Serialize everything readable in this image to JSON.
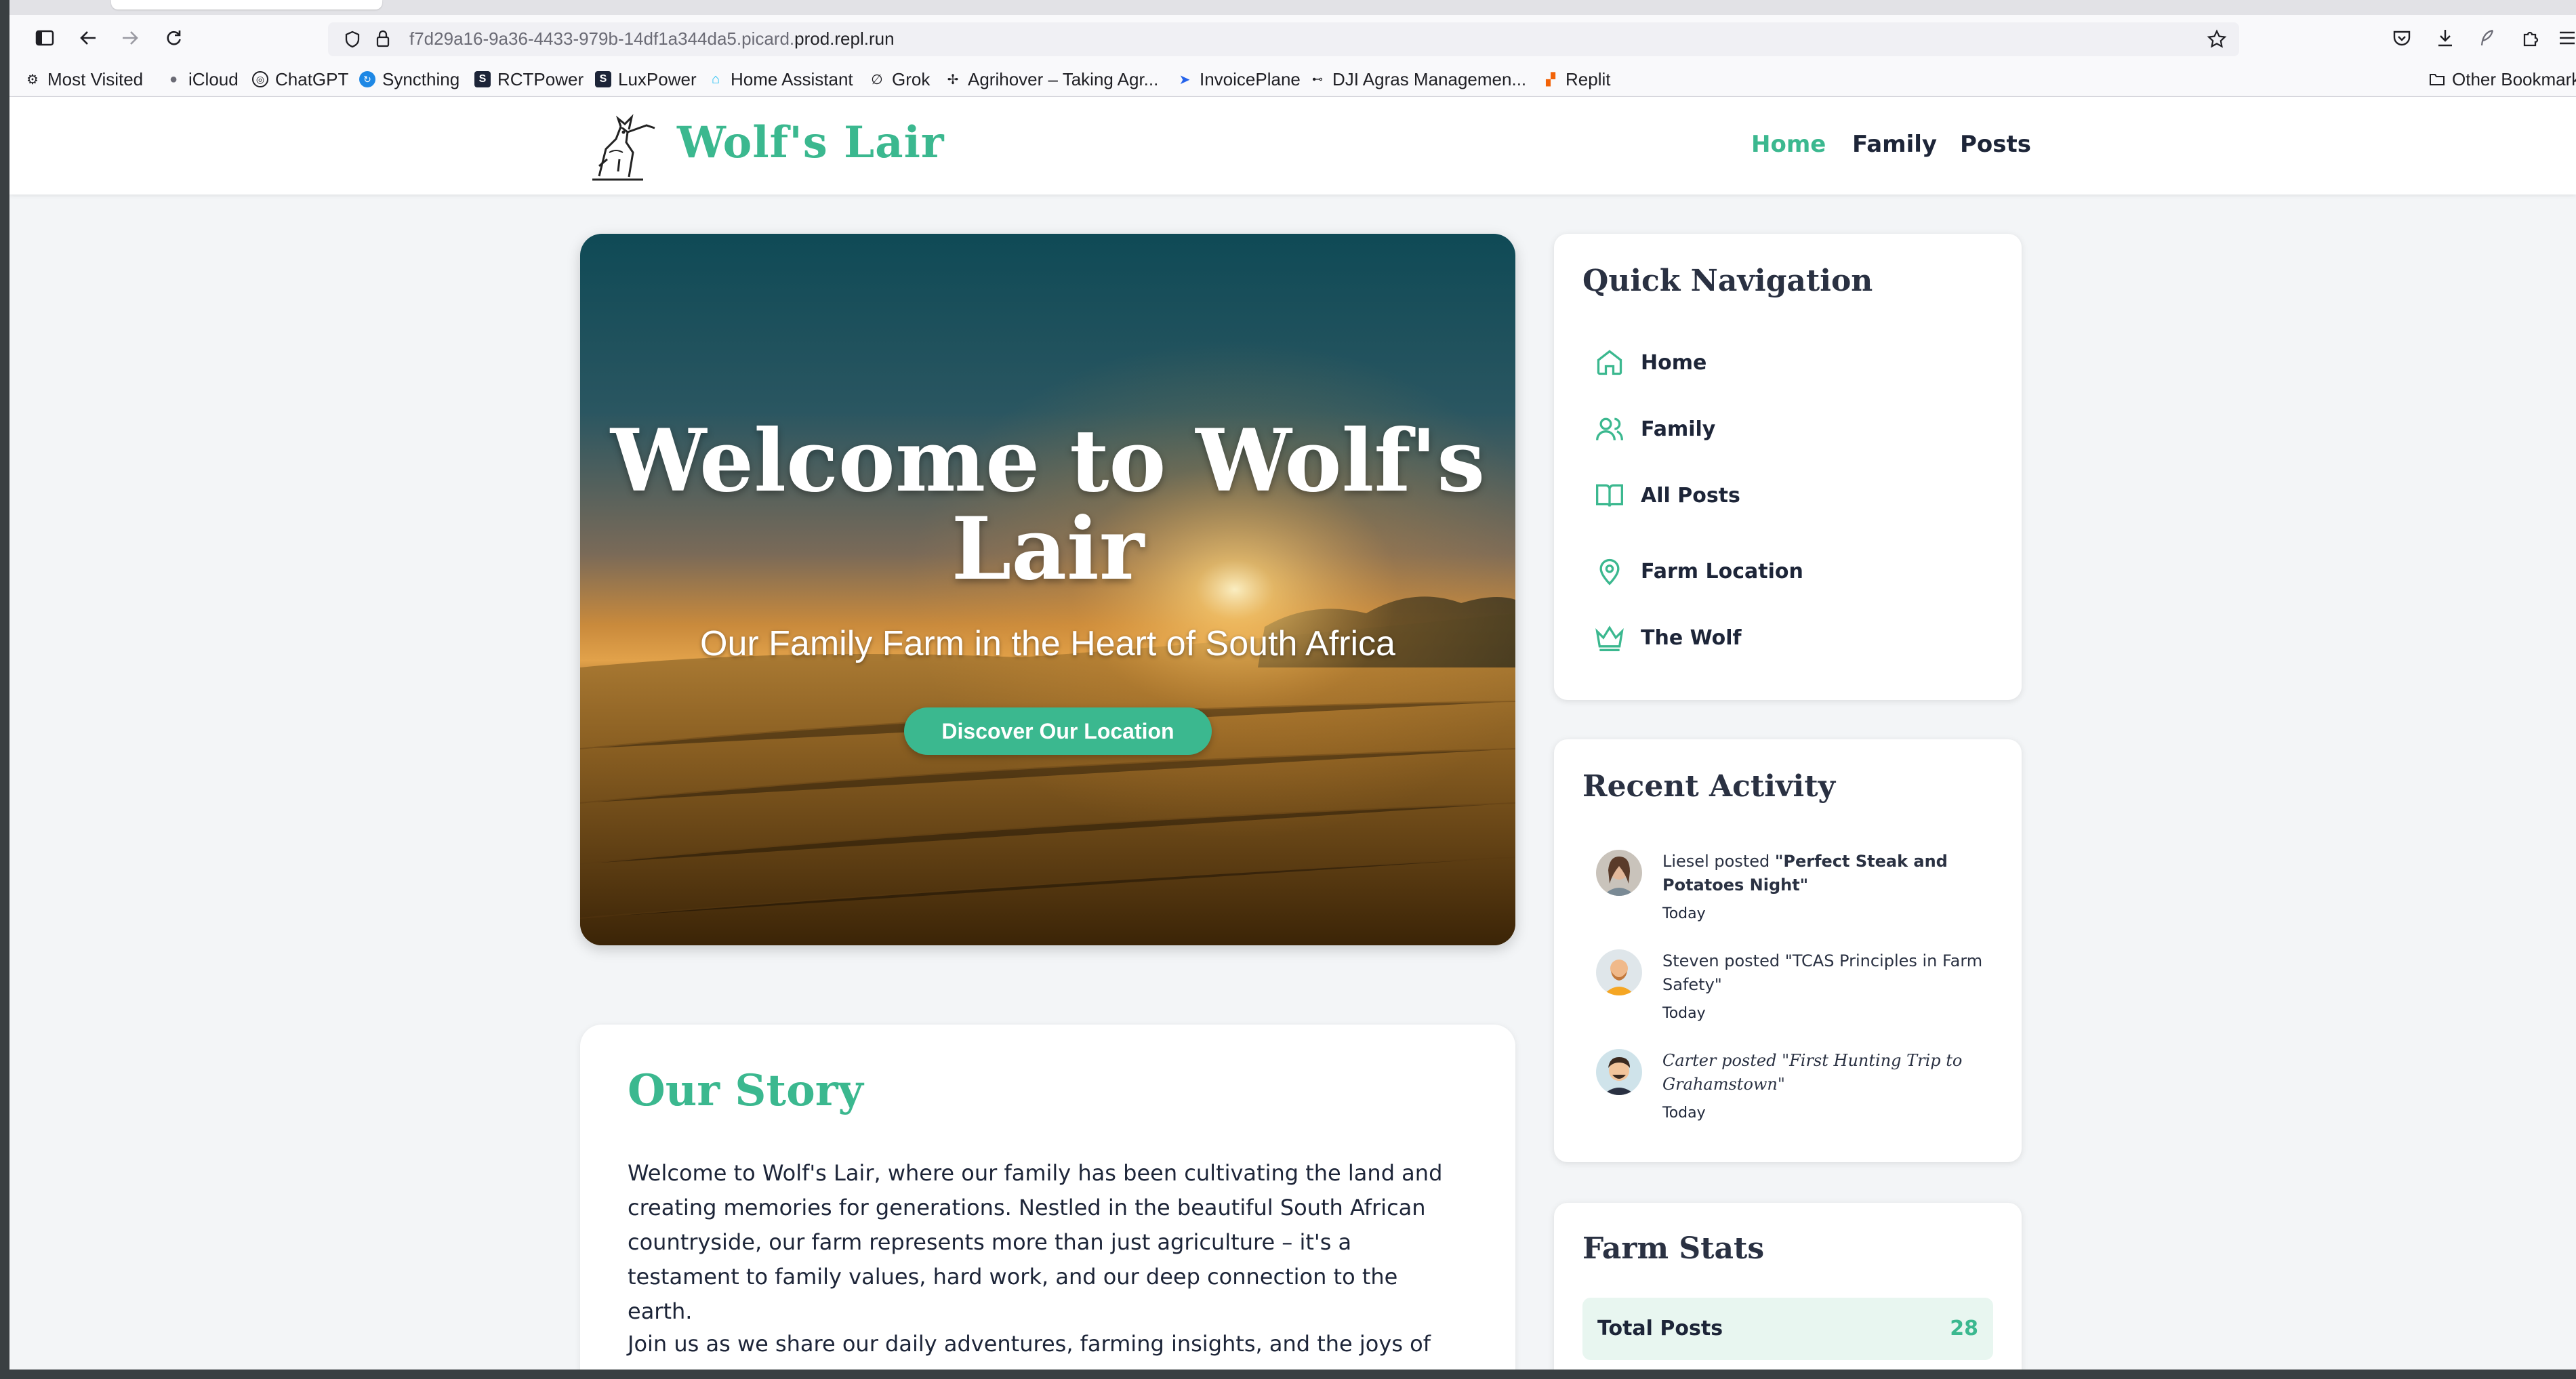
{
  "browser": {
    "url_path": "f7d29a16-9a36-4433-979b-14df1a344da5.picard.",
    "url_host": "prod.repl.run",
    "bookmarks": [
      {
        "label": "Most Visited",
        "icon": "gear-icon"
      },
      {
        "label": "iCloud",
        "icon": "apple-icon"
      },
      {
        "label": "ChatGPT",
        "icon": "chatgpt-icon"
      },
      {
        "label": "Syncthing",
        "icon": "syncthing-icon"
      },
      {
        "label": "RCTPower",
        "icon": "s-icon"
      },
      {
        "label": "LuxPower",
        "icon": "s-icon"
      },
      {
        "label": "Home Assistant",
        "icon": "home-assistant-icon"
      },
      {
        "label": "Grok",
        "icon": "grok-icon"
      },
      {
        "label": "Agrihover – Taking Agr...",
        "icon": "drone-icon"
      },
      {
        "label": "InvoicePlane",
        "icon": "plane-icon"
      },
      {
        "label": "DJI Agras Managemen...",
        "icon": "dji-icon"
      },
      {
        "label": "Replit",
        "icon": "replit-icon"
      }
    ],
    "other_bookmarks": "Other Bookmarks"
  },
  "site": {
    "title": "Wolf's Lair",
    "nav": [
      "Home",
      "Family",
      "Posts"
    ],
    "active_nav": "Home"
  },
  "hero": {
    "title": "Welcome to Wolf's Lair",
    "subtitle": "Our Family Farm in the Heart of South Africa",
    "cta": "Discover Our Location"
  },
  "story": {
    "heading": "Our Story",
    "p1": "Welcome to Wolf's Lair, where our family has been cultivating the land and creating memories for generations. Nestled in the beautiful South African countryside, our farm represents more than just agriculture – it's a testament to family values, hard work, and our deep connection to the earth.",
    "p2": "Join us as we share our daily adventures, farming insights, and the joys of"
  },
  "quick_nav": {
    "heading": "Quick Navigation",
    "items": [
      {
        "label": "Home",
        "icon": "home-icon"
      },
      {
        "label": "Family",
        "icon": "users-icon"
      },
      {
        "label": "All Posts",
        "icon": "book-icon"
      },
      {
        "label": "Farm Location",
        "icon": "map-pin-icon"
      },
      {
        "label": "The Wolf",
        "icon": "crown-icon"
      }
    ]
  },
  "recent_activity": {
    "heading": "Recent Activity",
    "items": [
      {
        "author": "Liesel",
        "verb": "posted",
        "title": "\"Perfect Steak and Potatoes Night\"",
        "when": "Today"
      },
      {
        "author": "Steven",
        "verb": "posted",
        "title": "\"TCAS Principles in Farm Safety\"",
        "when": "Today"
      },
      {
        "author": "Carter",
        "verb": "posted",
        "title": "\"First Hunting Trip to Grahamstown\"",
        "when": "Today"
      }
    ]
  },
  "farm_stats": {
    "heading": "Farm Stats",
    "rows": [
      {
        "label": "Total Posts",
        "value": "28"
      }
    ]
  },
  "colors": {
    "accent": "#3bb88f",
    "text": "#1d2538",
    "background": "#f3f5f7"
  }
}
